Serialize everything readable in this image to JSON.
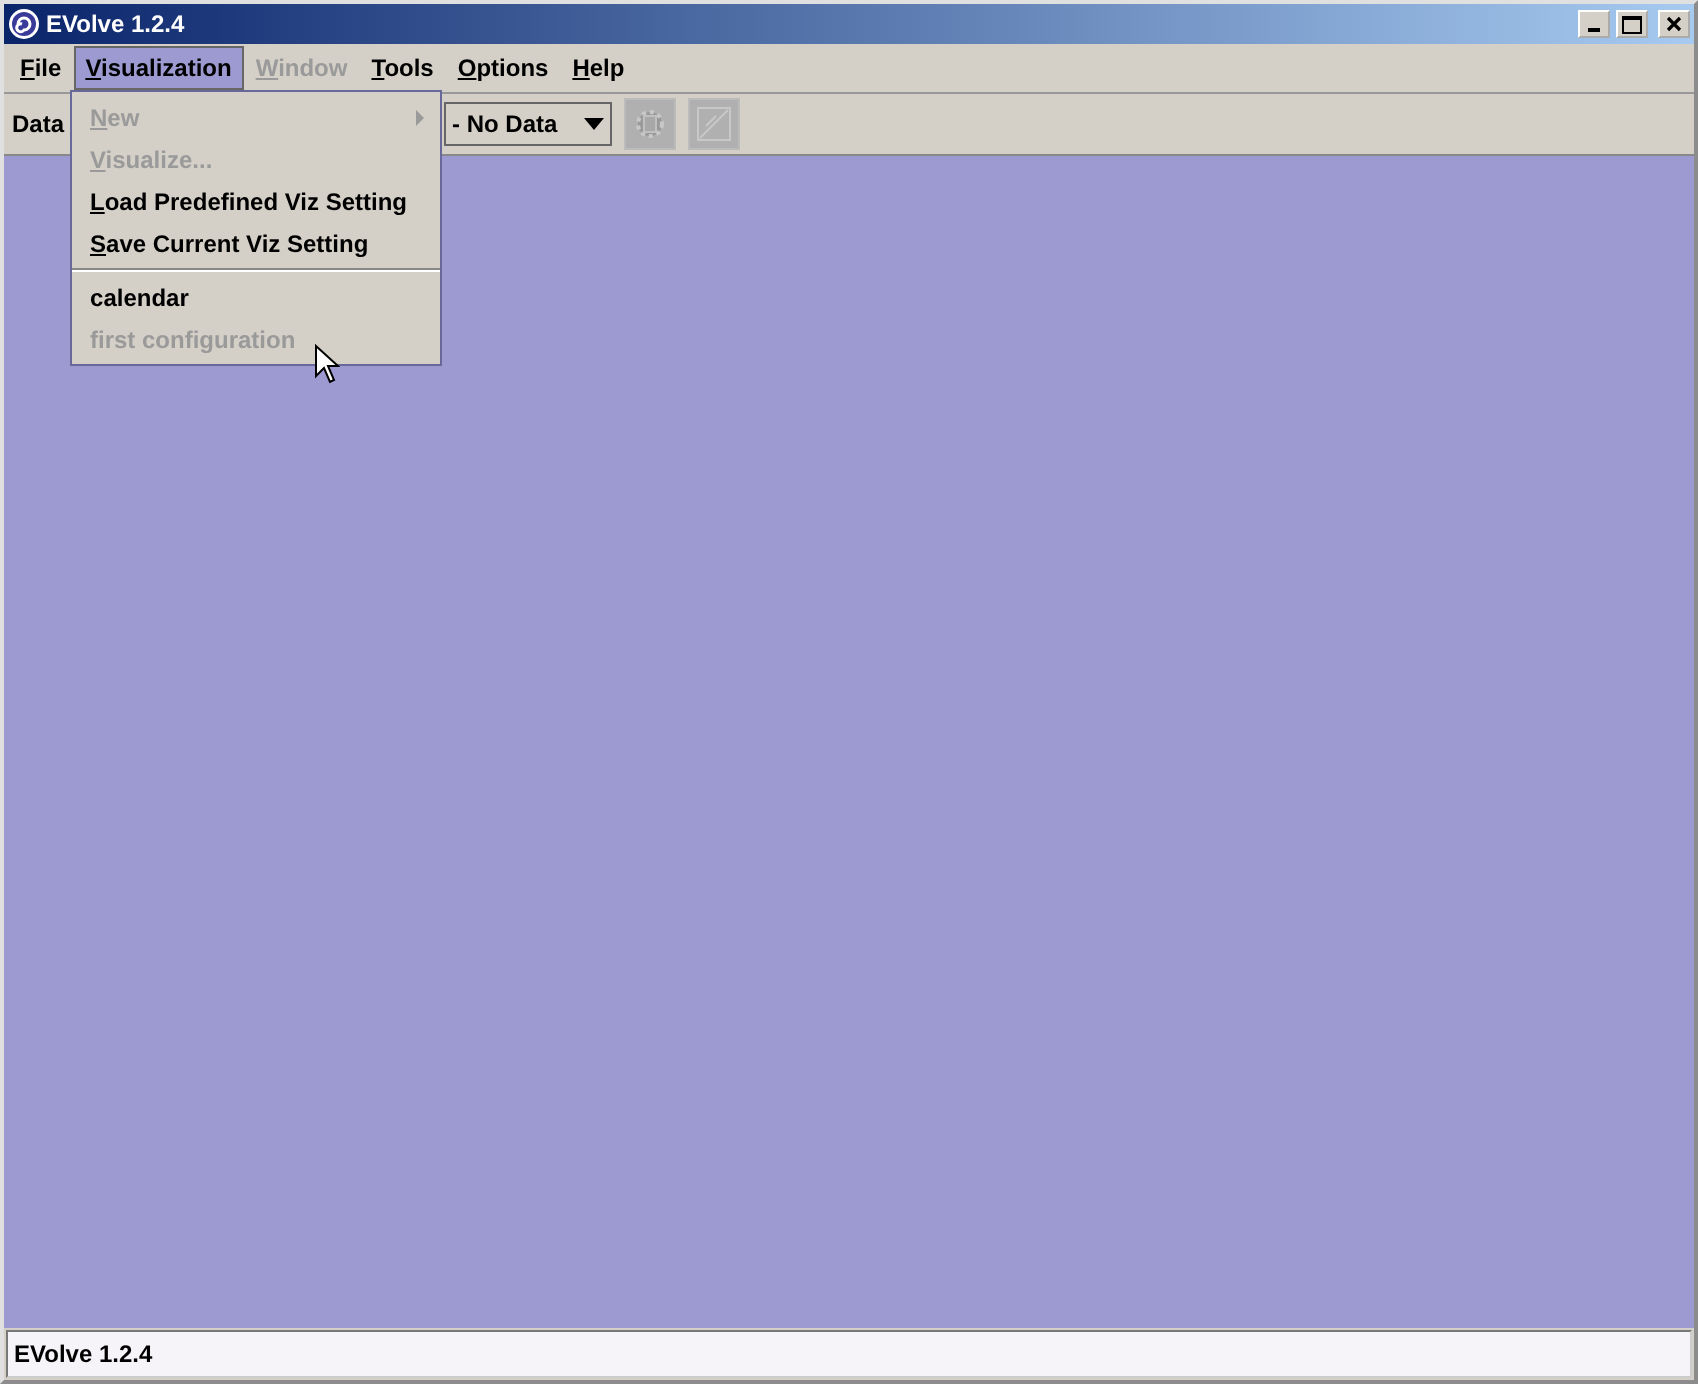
{
  "window": {
    "title": "EVolve 1.2.4"
  },
  "menubar": [
    {
      "label": "File",
      "selected": false,
      "disabled": false,
      "mnemonic": true
    },
    {
      "label": "Visualization",
      "selected": true,
      "disabled": false,
      "mnemonic": true
    },
    {
      "label": "Window",
      "selected": false,
      "disabled": true,
      "mnemonic": true
    },
    {
      "label": "Tools",
      "selected": false,
      "disabled": false,
      "mnemonic": true
    },
    {
      "label": "Options",
      "selected": false,
      "disabled": false,
      "mnemonic": true
    },
    {
      "label": "Help",
      "selected": false,
      "disabled": false,
      "mnemonic": true
    }
  ],
  "toolbar": {
    "label": "Data",
    "combo": {
      "value": "- No Data"
    },
    "buttons": [
      {
        "kind": "gear",
        "disabled": true
      },
      {
        "kind": "chart",
        "disabled": true
      }
    ]
  },
  "menu": {
    "items": [
      {
        "kind": "submenu",
        "label": "New",
        "disabled": true,
        "mnemonic": true
      },
      {
        "kind": "item",
        "label": "Visualize...",
        "disabled": true,
        "mnemonic": true
      },
      {
        "kind": "item",
        "label": "Load Predefined Viz Setting",
        "disabled": false,
        "mnemonic": true
      },
      {
        "kind": "item",
        "label": "Save Current Viz Setting",
        "disabled": false,
        "mnemonic": true
      },
      {
        "kind": "separator"
      },
      {
        "kind": "item",
        "label": "calendar",
        "disabled": false,
        "mnemonic": false
      },
      {
        "kind": "item",
        "label": "first configuration",
        "disabled": true,
        "mnemonic": false
      }
    ]
  },
  "status_bar": {
    "text": "EVolve 1.2.4"
  }
}
